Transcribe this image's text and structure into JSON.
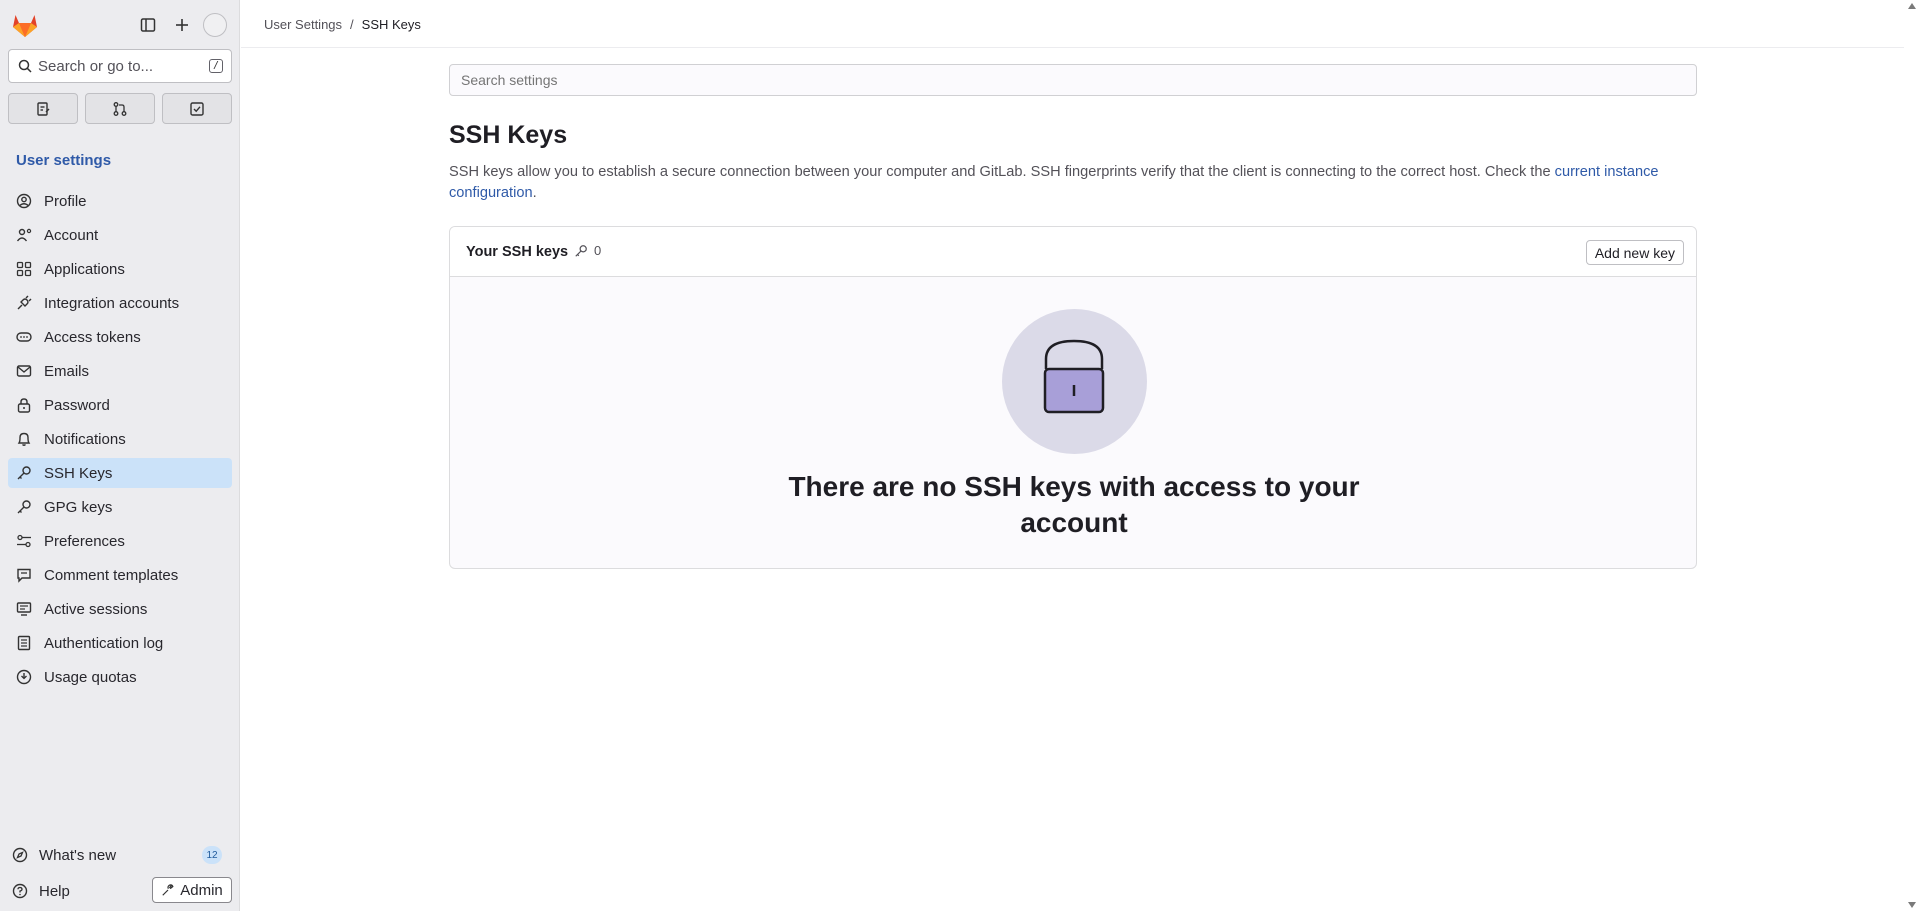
{
  "sidebar": {
    "search_label": "Search or go to...",
    "search_shortcut": "/",
    "title": "User settings",
    "items": [
      {
        "label": "Profile",
        "icon": "profile-icon"
      },
      {
        "label": "Account",
        "icon": "account-icon"
      },
      {
        "label": "Applications",
        "icon": "applications-icon"
      },
      {
        "label": "Integration accounts",
        "icon": "plug-icon"
      },
      {
        "label": "Access tokens",
        "icon": "token-icon"
      },
      {
        "label": "Emails",
        "icon": "mail-icon"
      },
      {
        "label": "Password",
        "icon": "lock-icon"
      },
      {
        "label": "Notifications",
        "icon": "bell-icon"
      },
      {
        "label": "SSH Keys",
        "icon": "key-icon",
        "active": true
      },
      {
        "label": "GPG keys",
        "icon": "key-icon"
      },
      {
        "label": "Preferences",
        "icon": "preferences-icon"
      },
      {
        "label": "Comment templates",
        "icon": "comment-icon"
      },
      {
        "label": "Active sessions",
        "icon": "monitor-icon"
      },
      {
        "label": "Authentication log",
        "icon": "log-icon"
      },
      {
        "label": "Usage quotas",
        "icon": "quota-icon"
      }
    ],
    "whats_new": "What's new",
    "whats_new_count": "12",
    "help": "Help",
    "admin": "Admin"
  },
  "breadcrumb": {
    "parent": "User Settings",
    "separator": "/",
    "current": "SSH Keys"
  },
  "main": {
    "search_placeholder": "Search settings",
    "title": "SSH Keys",
    "description": "SSH keys allow you to establish a secure connection between your computer and GitLab. SSH fingerprints verify that the client is connecting to the correct host. Check the",
    "description_link": "current instance configuration",
    "description_end": ".",
    "card": {
      "title": "Your SSH keys",
      "count": "0",
      "add_button": "Add new key",
      "empty_message": "There are no SSH keys with access to your account"
    }
  },
  "colors": {
    "accent": "#1f75cb",
    "active_bg": "#cbe2f9",
    "link": "#2f5aa8",
    "illustration_bg": "#dbdae8",
    "lock_fill": "#a89fd8"
  }
}
